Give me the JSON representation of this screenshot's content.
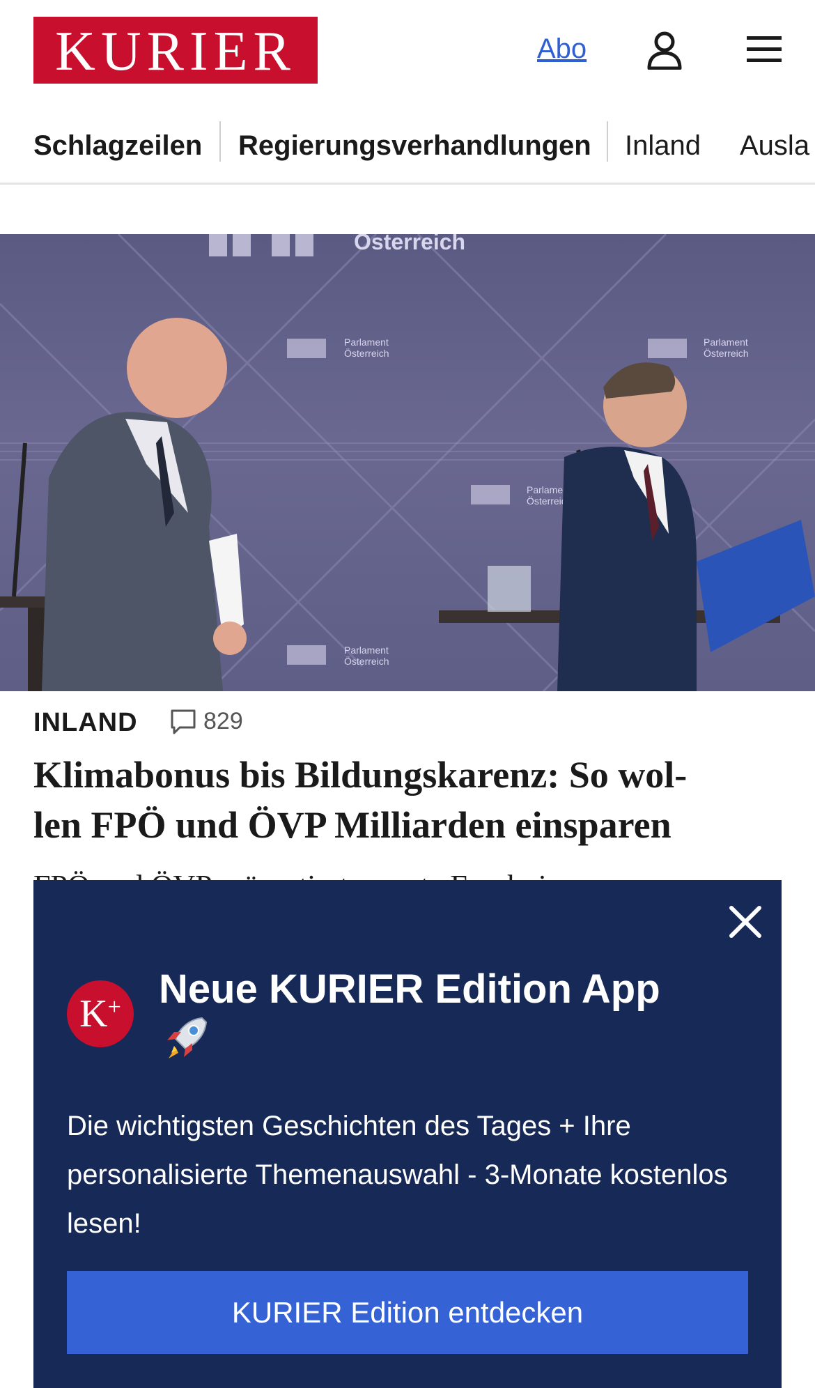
{
  "header": {
    "logo_text": "KURIER",
    "abo_label": "Abo",
    "user_icon": "user-icon",
    "menu_icon": "hamburger-menu-icon"
  },
  "nav": {
    "items": [
      "Schlagzeilen",
      "Regierungsverhandlungen",
      "Inland",
      "Ausla"
    ]
  },
  "hero": {
    "backdrop_text": [
      "Österreich",
      "Parlament",
      "Österreich",
      "Parlament",
      "Österreich",
      "Parlament",
      "Österreich",
      "Parlament",
      "Österreich"
    ]
  },
  "article": {
    "kicker": "INLAND",
    "comment_count": "829",
    "headline_line1": "Klimabonus bis Bildungskarenz: So wol-",
    "headline_line2": "len FPÖ und ÖVP Milliarden einsparen",
    "teaser_peek": "FPÖ und ÖVP präsentierten erste Ergebnisse"
  },
  "popup": {
    "badge_text": "K+",
    "title": "Neue KURIER Edition App",
    "emoji_icon": "rocket-icon",
    "body": "Die wichtigsten Geschichten des Tages + Ihre personalisierte Themenauswahl - 3-Monate kostenlos lesen!",
    "cta_label": "KURIER Edition entdecken",
    "close_icon": "close-icon"
  },
  "colors": {
    "brand_red": "#c8102e",
    "popup_navy": "#172957",
    "cta_blue": "#3563d6",
    "link_blue": "#2f5fd0"
  }
}
